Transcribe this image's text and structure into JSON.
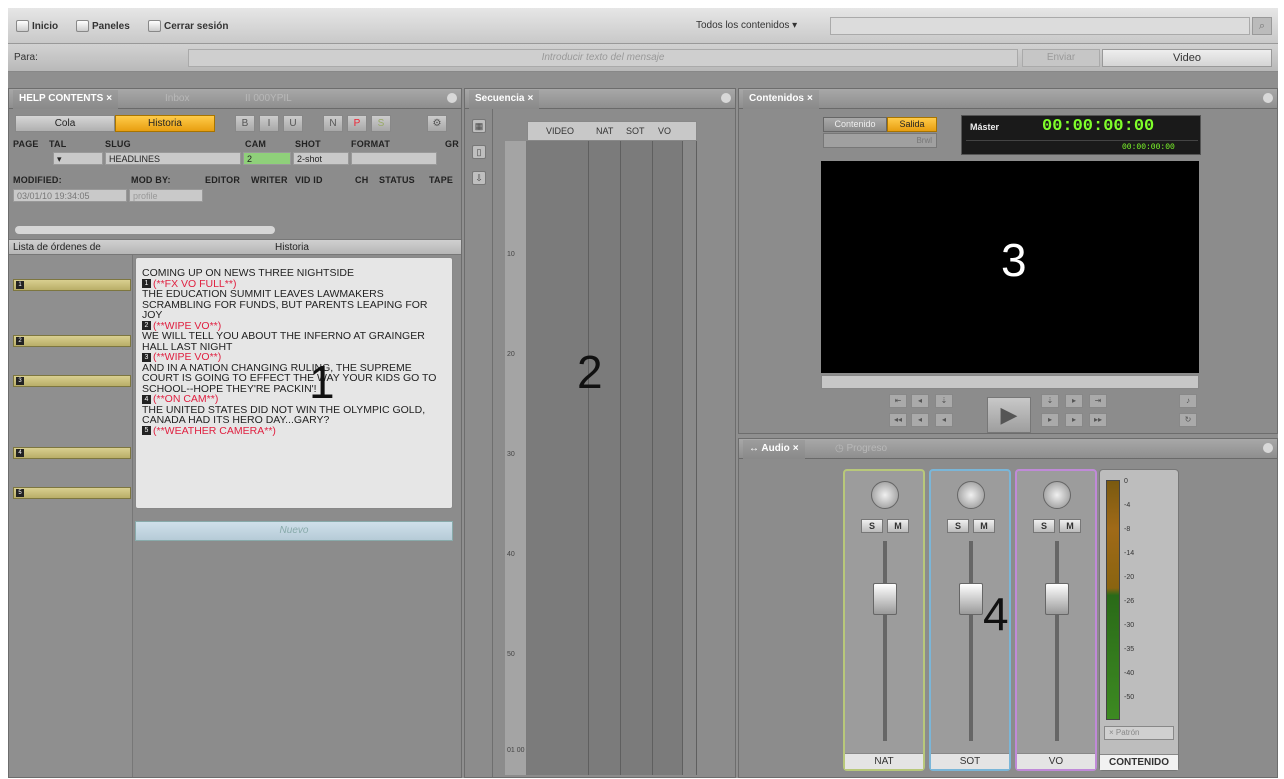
{
  "topbar": {
    "inicio": "Inicio",
    "paneles": "Paneles",
    "cerrar": "Cerrar sesión",
    "filter": "Todos los contenidos"
  },
  "msgbar": {
    "para": "Para:",
    "placeholder": "Introducir texto del mensaje",
    "send": "Enviar",
    "media": "Video"
  },
  "panel1": {
    "tab_active": "HELP CONTENTS",
    "tab2": "Inbox",
    "tab3": "II 000YPIL",
    "cola": "Cola",
    "historia": "Historia",
    "fmt": [
      "B",
      "I",
      "U",
      "N",
      "P",
      "S"
    ],
    "labels": {
      "page": "PAGE",
      "tal": "TAL",
      "slug": "SLUG",
      "cam": "CAM",
      "shot": "SHOT",
      "format": "FORMAT",
      "gr": "GR",
      "modified": "MODIFIED:",
      "mod_by": "MOD BY:",
      "editor": "EDITOR",
      "writer": "WRITER",
      "vid_id": "VID ID",
      "ch": "CH",
      "status": "STATUS",
      "tape": "TAPE"
    },
    "values": {
      "slug": "HEADLINES",
      "cam": "2",
      "shot": "2-shot",
      "modified": "03/01/10 19:34:05",
      "mod_by": "profile"
    },
    "list_header_left": "Lista de órdenes de",
    "list_header_right": "Historia",
    "story": [
      {
        "t": "COMING UP ON NEWS THREE NIGHTSIDE",
        "cue": false
      },
      {
        "t": "(**FX VO FULL**)",
        "cue": true,
        "n": "1"
      },
      {
        "t": "THE EDUCATION SUMMIT LEAVES LAWMAKERS SCRAMBLING FOR FUNDS, BUT PARENTS LEAPING FOR JOY",
        "cue": false
      },
      {
        "t": "(**WIPE VO**)",
        "cue": true,
        "n": "2"
      },
      {
        "t": "WE WILL TELL YOU ABOUT THE INFERNO AT GRAINGER HALL LAST NIGHT",
        "cue": false
      },
      {
        "t": "(**WIPE VO**)",
        "cue": true,
        "n": "3"
      },
      {
        "t": "AND IN A NATION CHANGING RULING, THE SUPREME COURT IS GOING TO EFFECT THE WAY YOUR KIDS GO TO SCHOOL--HOPE THEY'RE PACKIN'!",
        "cue": false
      },
      {
        "t": "(**ON CAM**)",
        "cue": true,
        "n": "4"
      },
      {
        "t": "THE UNITED STATES DID NOT WIN THE OLYMPIC GOLD, CANADA HAD ITS HERO DAY...GARY?",
        "cue": false
      },
      {
        "t": "(**WEATHER CAMERA**)",
        "cue": true,
        "n": "5"
      }
    ],
    "nuevo": "Nuevo",
    "rundown": [
      "1",
      "2",
      "3",
      "4",
      "5"
    ],
    "label": "1"
  },
  "panel2": {
    "tab": "Secuencia",
    "cols": [
      "VIDEO",
      "NAT",
      "SOT",
      "VO"
    ],
    "ruler": [
      "10",
      "20",
      "30",
      "40",
      "50",
      "01 00"
    ],
    "label": "2"
  },
  "panel3": {
    "tab": "Contenidos",
    "contenido": "Contenido",
    "salida": "Salida",
    "brw": "Brwl",
    "master": "Máster",
    "timecode": "00:00:00:00",
    "timecode2": "00:00:00:00",
    "label": "3"
  },
  "panel4": {
    "tab": "Audio",
    "tab2": "Progreso",
    "strips": [
      {
        "name": "NAT",
        "color": "#b8c87a"
      },
      {
        "name": "SOT",
        "color": "#7ab6d8"
      },
      {
        "name": "VO",
        "color": "#c08ad8"
      }
    ],
    "meter_name": "CONTENIDO",
    "meter_ticks": [
      "0",
      "-4",
      "-8",
      "-14",
      "-20",
      "-26",
      "-30",
      "-35",
      "-40",
      "-50"
    ],
    "meter_btn": "Patrón",
    "s": "S",
    "m": "M",
    "label": "4"
  }
}
